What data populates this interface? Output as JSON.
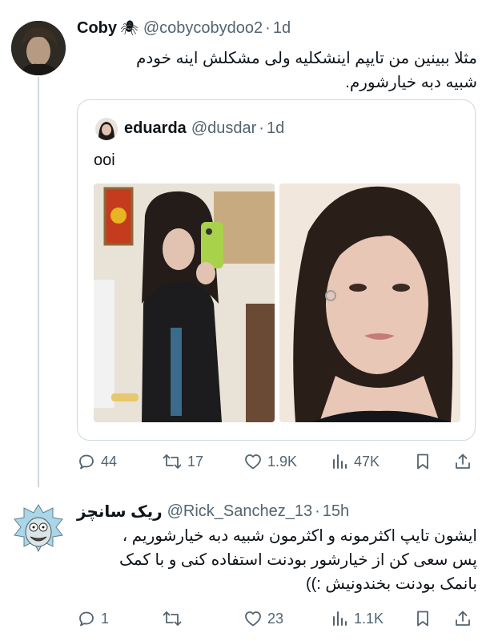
{
  "tweet1": {
    "name": "Coby",
    "name_emoji": "🕷",
    "handle": "@cobycobydoo2",
    "dot": "·",
    "time": "1d",
    "text_line1": "مثلا ببینین من تایپم اینشکلیه ولی مشکلش اینه خودم",
    "text_line2": "شبیه دبه خیارشورم.",
    "quote": {
      "name": "eduarda",
      "handle": "@dusdar",
      "dot": "·",
      "time": "1d",
      "text": "ooi"
    },
    "actions": {
      "replies": "44",
      "retweets": "17",
      "likes": "1.9K",
      "views": "47K"
    }
  },
  "tweet2": {
    "name": "ریک سانچز",
    "handle": "@Rick_Sanchez_13",
    "dot": "·",
    "time": "15h",
    "text_line1": "ایشون تایپ اکثرمونه و اکثرمون شبیه دبه خیارشوریم ،",
    "text_line2": "پس سعی کن از خیارشور بودنت استفاده کنی و با کمک",
    "text_line3": "بانمک بودنت بخندونیش :))",
    "actions": {
      "replies": "1",
      "retweets": "",
      "likes": "23",
      "views": "1.1K"
    }
  },
  "colors": {
    "text": "#0f1419",
    "secondary": "#536471",
    "border": "#cfd9de"
  }
}
